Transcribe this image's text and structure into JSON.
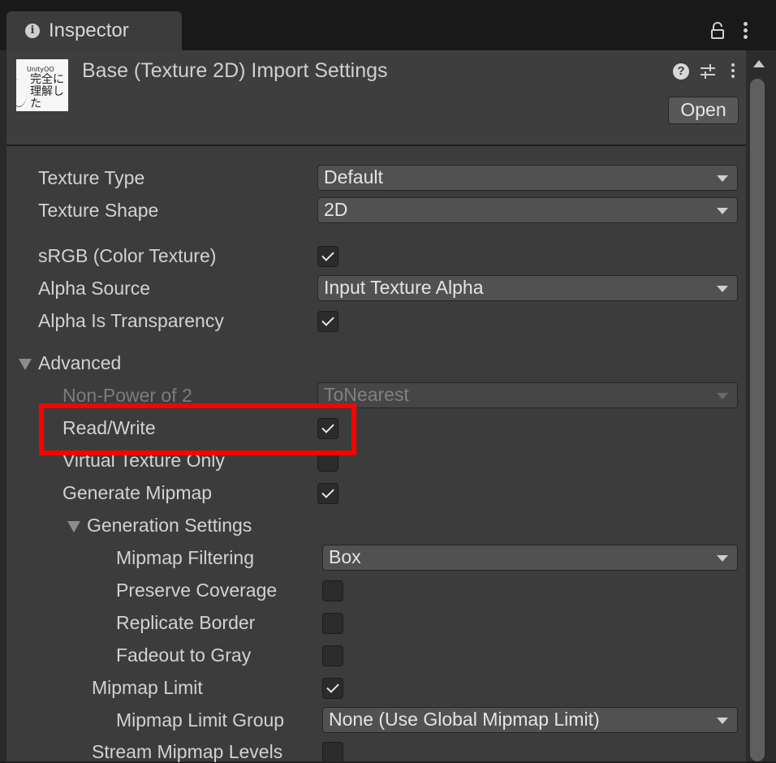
{
  "window": {
    "tab_title": "Inspector",
    "tab_icon": "info-icon"
  },
  "header": {
    "thumbnail": {
      "line1": "UnityOO",
      "line2": "完全に理解した"
    },
    "title": "Base (Texture 2D) Import Settings",
    "open_label": "Open"
  },
  "fields": {
    "texture_type": {
      "label": "Texture Type",
      "value": "Default"
    },
    "texture_shape": {
      "label": "Texture Shape",
      "value": "2D"
    },
    "srgb": {
      "label": "sRGB (Color Texture)",
      "checked": true
    },
    "alpha_source": {
      "label": "Alpha Source",
      "value": "Input Texture Alpha"
    },
    "alpha_is_transparency": {
      "label": "Alpha Is Transparency",
      "checked": true
    },
    "advanced": {
      "label": "Advanced",
      "expanded": true
    },
    "non_power_of_2": {
      "label": "Non-Power of 2",
      "value": "ToNearest",
      "disabled": true
    },
    "read_write": {
      "label": "Read/Write",
      "checked": true,
      "highlighted": true
    },
    "virtual_texture_only": {
      "label": "Virtual Texture Only",
      "checked": false
    },
    "generate_mipmap": {
      "label": "Generate Mipmap",
      "checked": true
    },
    "generation_settings": {
      "label": "Generation Settings",
      "expanded": true
    },
    "mipmap_filtering": {
      "label": "Mipmap Filtering",
      "value": "Box"
    },
    "preserve_coverage": {
      "label": "Preserve Coverage",
      "checked": false
    },
    "replicate_border": {
      "label": "Replicate Border",
      "checked": false
    },
    "fadeout_to_gray": {
      "label": "Fadeout to Gray",
      "checked": false
    },
    "mipmap_limit": {
      "label": "Mipmap Limit",
      "checked": true
    },
    "mipmap_limit_group": {
      "label": "Mipmap Limit Group",
      "value": "None (Use Global Mipmap Limit)"
    },
    "stream_mipmap_levels": {
      "label": "Stream Mipmap Levels",
      "checked": false
    }
  },
  "colors": {
    "panel": "#3c3c3c",
    "highlight": "#ff0000"
  }
}
